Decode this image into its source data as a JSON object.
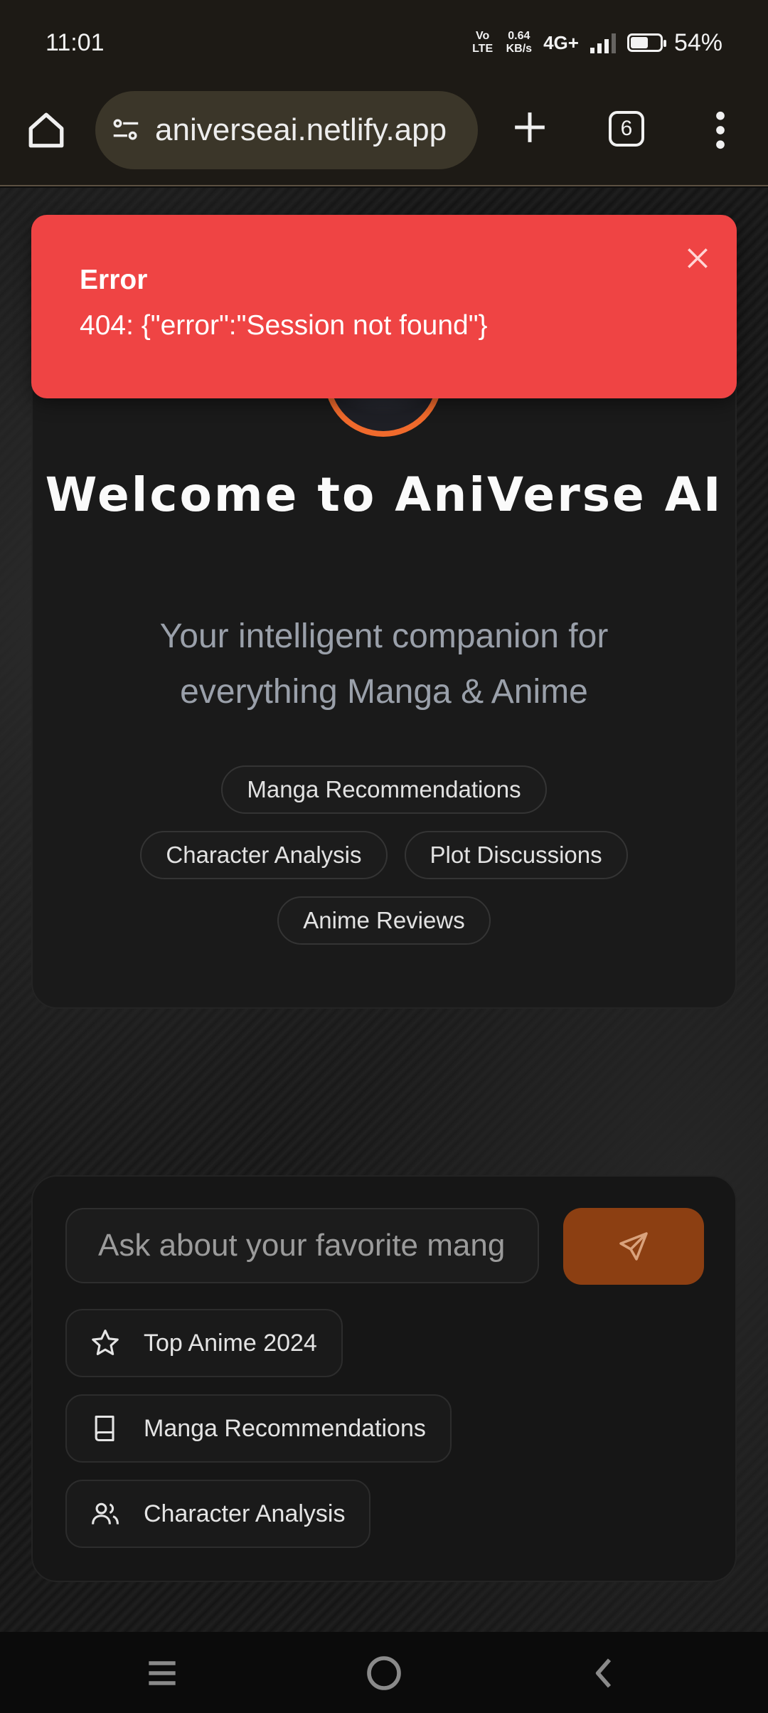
{
  "status_bar": {
    "time": "11:01",
    "volte": "Vo LTE",
    "speed_value": "0.64",
    "speed_unit": "KB/s",
    "network": "4G+",
    "battery_level": 0.54,
    "battery_text": "54%"
  },
  "browser": {
    "url": "aniverseai.netlify.app",
    "tab_count": "6"
  },
  "toast": {
    "title": "Error",
    "message": "404: {\"error\":\"Session not found\"}"
  },
  "welcome": {
    "title": "Welcome to AniVerse AI",
    "subtitle": "Your intelligent companion for everything Manga & Anime",
    "chips": [
      "Manga Recommendations",
      "Character Analysis",
      "Plot Discussions",
      "Anime Reviews"
    ]
  },
  "chat": {
    "placeholder": "Ask about your favorite manga or anime...",
    "quick_actions": [
      {
        "label": "Top Anime 2024",
        "icon": "star-icon"
      },
      {
        "label": "Manga Recommendations",
        "icon": "book-icon"
      },
      {
        "label": "Character Analysis",
        "icon": "users-icon"
      }
    ]
  },
  "colors": {
    "toast_bg": "#ef4444",
    "accent": "#f06a2c",
    "send_bg": "#8c3f12"
  }
}
